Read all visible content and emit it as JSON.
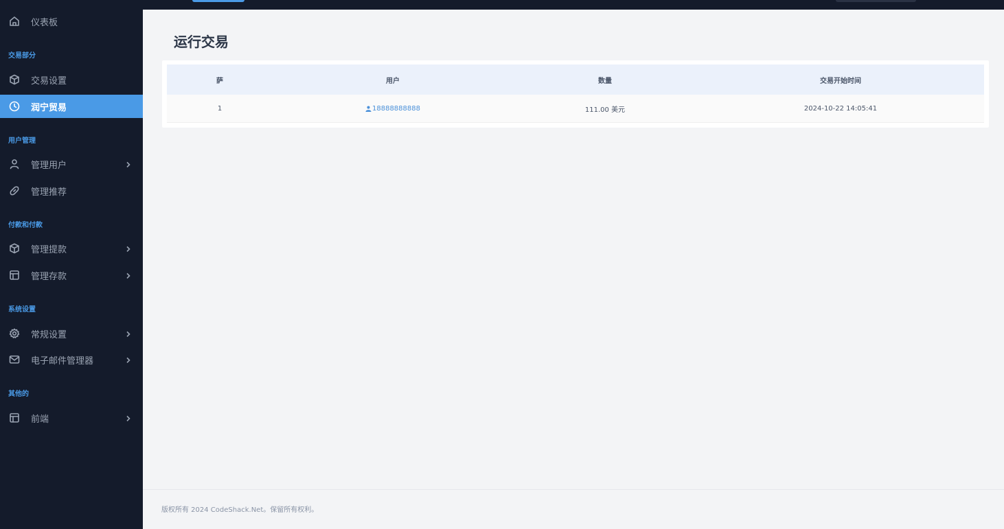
{
  "sidebar": {
    "dashboard": "仪表板",
    "sections": [
      "交易部分",
      "用户管理",
      "付款和付款",
      "系统设置",
      "其他的"
    ],
    "items": [
      {
        "label": "交易设置",
        "icon": "cube-icon"
      },
      {
        "label": "润宁贸易",
        "icon": "clock-icon"
      },
      {
        "label": "管理用户",
        "icon": "user-icon"
      },
      {
        "label": "管理推荐",
        "icon": "link-icon"
      },
      {
        "label": "管理提款",
        "icon": "cube-icon"
      },
      {
        "label": "管理存款",
        "icon": "table-icon"
      },
      {
        "label": "常规设置",
        "icon": "gear-icon"
      },
      {
        "label": "电子邮件管理器",
        "icon": "mail-icon"
      },
      {
        "label": "前端",
        "icon": "layout-icon"
      }
    ],
    "active_color": "#4a9ae6"
  },
  "main": {
    "title": "运行交易",
    "table": {
      "headers": [
        "萨",
        "用户",
        "数量",
        "交易开始时间"
      ],
      "rows": [
        {
          "id": "1",
          "user": "18888888888",
          "amount": "111.00 美元",
          "start_time": "2024-10-22 14:05:41"
        }
      ]
    }
  },
  "footer": {
    "text": "版权所有 2024 CodeShack.Net。保留所有权利。"
  }
}
